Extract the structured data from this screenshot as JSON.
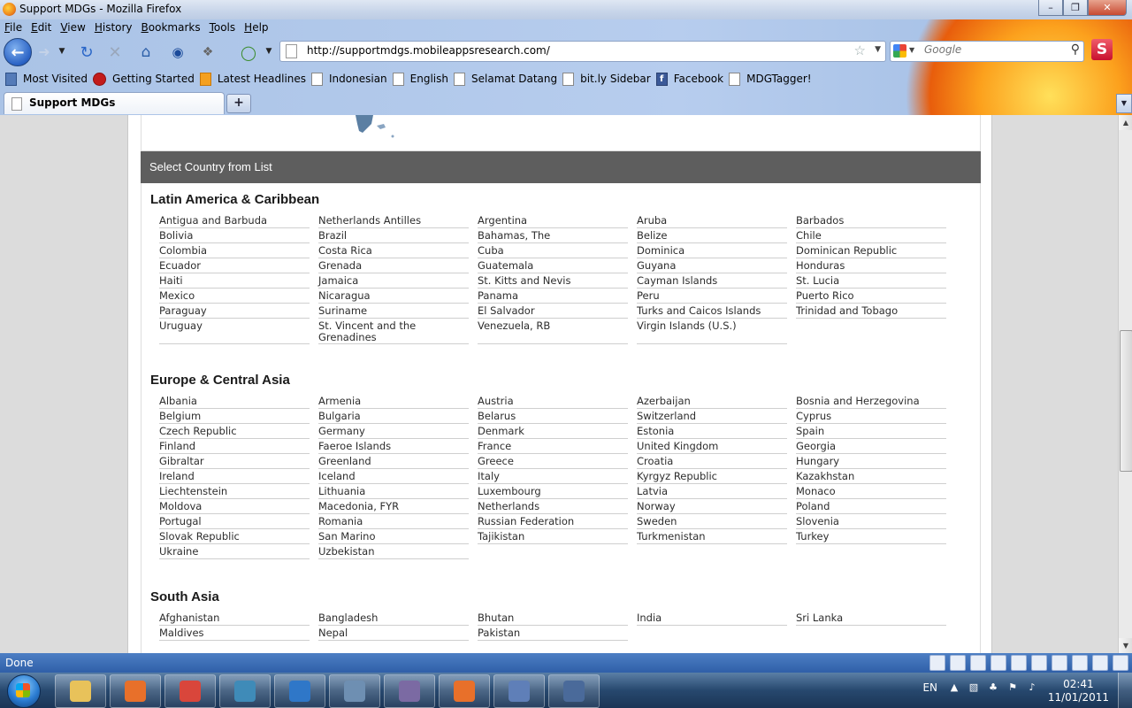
{
  "window": {
    "title": "Support MDGs - Mozilla Firefox"
  },
  "menu": [
    "File",
    "Edit",
    "View",
    "History",
    "Bookmarks",
    "Tools",
    "Help"
  ],
  "url": "http://supportmdgs.mobileappsresearch.com/",
  "search": {
    "placeholder": "Google"
  },
  "bookmarks": [
    "Most Visited",
    "Getting Started",
    "Latest Headlines",
    "Indonesian",
    "English",
    "Selamat Datang",
    "bit.ly Sidebar",
    "Facebook",
    "MDGTagger!"
  ],
  "tab": {
    "label": "Support MDGs",
    "new_tab_symbol": "+"
  },
  "section": {
    "title": "Select Country from List"
  },
  "regions": [
    {
      "name": "Latin America & Caribbean",
      "countries": [
        "Antigua and Barbuda",
        "Netherlands Antilles",
        "Argentina",
        "Aruba",
        "Barbados",
        "Bolivia",
        "Brazil",
        "Bahamas, The",
        "Belize",
        "Chile",
        "Colombia",
        "Costa Rica",
        "Cuba",
        "Dominica",
        "Dominican Republic",
        "Ecuador",
        "Grenada",
        "Guatemala",
        "Guyana",
        "Honduras",
        "Haiti",
        "Jamaica",
        "St. Kitts and Nevis",
        "Cayman Islands",
        "St. Lucia",
        "Mexico",
        "Nicaragua",
        "Panama",
        "Peru",
        "Puerto Rico",
        "Paraguay",
        "Suriname",
        "El Salvador",
        "Turks and Caicos Islands",
        "Trinidad and Tobago",
        "Uruguay",
        "St. Vincent and the Grenadines",
        "Venezuela, RB",
        "Virgin Islands (U.S.)"
      ]
    },
    {
      "name": "Europe & Central Asia",
      "countries": [
        "Albania",
        "Armenia",
        "Austria",
        "Azerbaijan",
        "Bosnia and Herzegovina",
        "Belgium",
        "Bulgaria",
        "Belarus",
        "Switzerland",
        "Cyprus",
        "Czech Republic",
        "Germany",
        "Denmark",
        "Estonia",
        "Spain",
        "Finland",
        "Faeroe Islands",
        "France",
        "United Kingdom",
        "Georgia",
        "Gibraltar",
        "Greenland",
        "Greece",
        "Croatia",
        "Hungary",
        "Ireland",
        "Iceland",
        "Italy",
        "Kyrgyz Republic",
        "Kazakhstan",
        "Liechtenstein",
        "Lithuania",
        "Luxembourg",
        "Latvia",
        "Monaco",
        "Moldova",
        "Macedonia, FYR",
        "Netherlands",
        "Norway",
        "Poland",
        "Portugal",
        "Romania",
        "Russian Federation",
        "Sweden",
        "Slovenia",
        "Slovak Republic",
        "San Marino",
        "Tajikistan",
        "Turkmenistan",
        "Turkey",
        "Ukraine",
        "Uzbekistan"
      ]
    },
    {
      "name": "South Asia",
      "countries": [
        "Afghanistan",
        "Bangladesh",
        "Bhutan",
        "India",
        "Sri Lanka",
        "Maldives",
        "Nepal",
        "Pakistan"
      ]
    }
  ],
  "status": {
    "text": "Done"
  },
  "taskbar": {
    "language": "EN",
    "time": "02:41",
    "date": "11/01/2011",
    "apps": [
      {
        "name": "file-explorer",
        "color": "#e8c25a"
      },
      {
        "name": "firefox",
        "color": "#e8702a"
      },
      {
        "name": "chrome",
        "color": "#d9463b"
      },
      {
        "name": "app-3",
        "color": "#3f8bb8"
      },
      {
        "name": "internet-explorer",
        "color": "#2f77c8"
      },
      {
        "name": "mysql-workbench",
        "color": "#6e8fb2"
      },
      {
        "name": "tor",
        "color": "#7b6aa3"
      },
      {
        "name": "firefox-2",
        "color": "#e8702a"
      },
      {
        "name": "app-8",
        "color": "#5f7fb8"
      },
      {
        "name": "app-9",
        "color": "#4a6a9a"
      }
    ]
  }
}
